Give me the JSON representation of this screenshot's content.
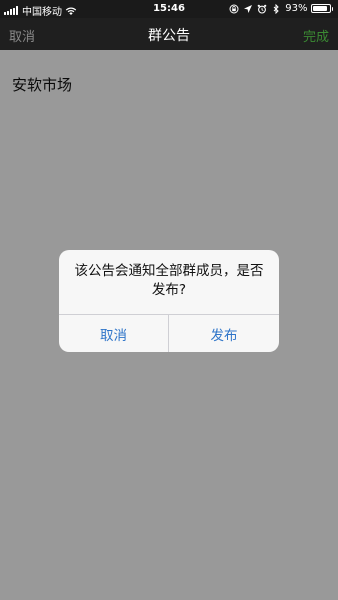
{
  "status_bar": {
    "carrier": "中国移动",
    "time": "15:46",
    "battery_percent": "93%",
    "battery_level": 0.93,
    "icons": [
      "signal-icon",
      "wifi-icon",
      "screen-lock-icon",
      "location-icon",
      "alarm-icon",
      "bluetooth-icon",
      "battery-icon"
    ]
  },
  "nav": {
    "cancel_label": "取消",
    "title": "群公告",
    "done_label": "完成"
  },
  "content": {
    "announcement_text": "安软市场"
  },
  "alert": {
    "message": "该公告会通知全部群成员，是否发布?",
    "cancel_label": "取消",
    "publish_label": "发布"
  },
  "colors": {
    "status_bar_bg": "#1a1a1a",
    "nav_bg": "#1f1f1f",
    "done_green": "#3b8a33",
    "cancel_gray": "#8a8a8a",
    "alert_button_blue": "#2f75c9",
    "overlay": "rgba(0,0,0,0.40)"
  }
}
